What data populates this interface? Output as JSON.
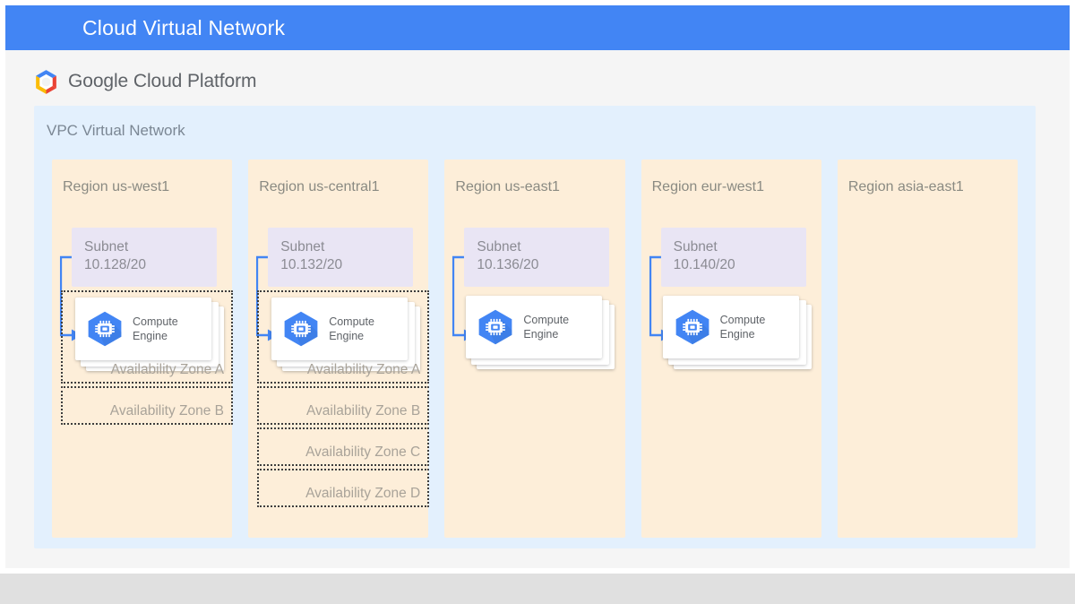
{
  "header": {
    "title": "Cloud Virtual Network",
    "bar_color": "#4285f4"
  },
  "brand": {
    "logo_icon": "google-cloud-platform-hexagon-logo",
    "word_google": "Google",
    "word_cloud_platform": "Cloud Platform"
  },
  "vpc": {
    "label": "VPC Virtual Network",
    "background": "#e3f0fd"
  },
  "compute_engine": {
    "icon": "compute-engine-cpu-hexagon-icon",
    "line1": "Compute",
    "line2": "Engine"
  },
  "connector": {
    "color": "#4285f4",
    "description": "elbow arrow from subnet to compute engine"
  },
  "regions": [
    {
      "name": "Region us-west1",
      "subnet": {
        "line1": "Subnet",
        "line2": "10.128/20"
      },
      "has_compute": true,
      "zones": [
        "Availability Zone A",
        "Availability Zone B"
      ]
    },
    {
      "name": "Region us-central1",
      "subnet": {
        "line1": "Subnet",
        "line2": "10.132/20"
      },
      "has_compute": true,
      "zones": [
        "Availability Zone A",
        "Availability Zone B",
        "Availability Zone C",
        "Availability Zone D"
      ]
    },
    {
      "name": "Region us-east1",
      "subnet": {
        "line1": "Subnet",
        "line2": "10.136/20"
      },
      "has_compute": true,
      "zones": []
    },
    {
      "name": "Region eur-west1",
      "subnet": {
        "line1": "Subnet",
        "line2": "10.140/20"
      },
      "has_compute": true,
      "zones": []
    },
    {
      "name": "Region asia-east1",
      "subnet": null,
      "has_compute": false,
      "zones": []
    }
  ],
  "colors": {
    "region_fill": "#fdeed9",
    "subnet_fill": "#e9e5f4",
    "zone_border": "#3d3d3d",
    "accent_blue": "#4285f4"
  }
}
